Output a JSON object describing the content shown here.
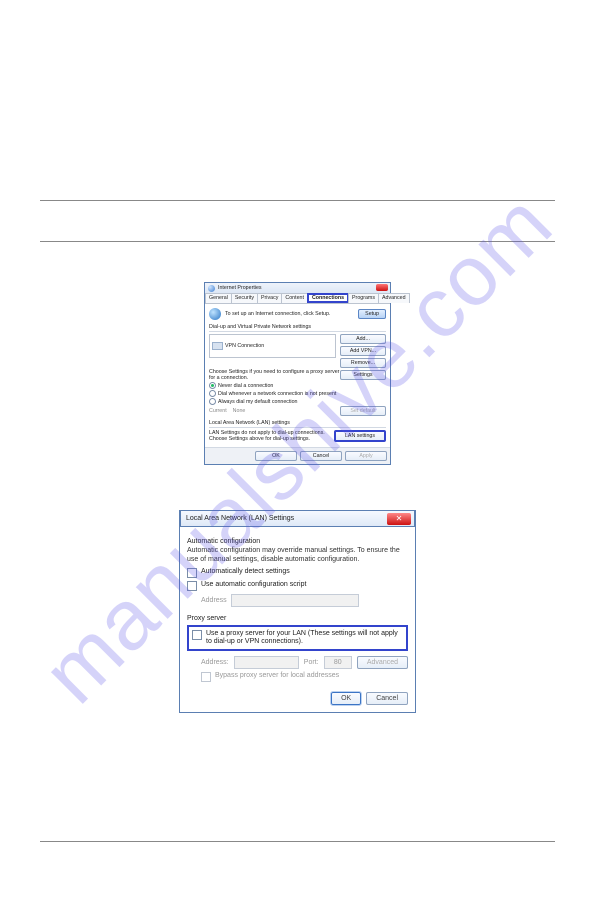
{
  "watermark": "manualshive.com",
  "dlg1": {
    "title": "Internet Properties",
    "tabs": [
      "General",
      "Security",
      "Privacy",
      "Content",
      "Connections",
      "Programs",
      "Advanced"
    ],
    "intro": "To set up an Internet connection, click Setup.",
    "setup_btn": "Setup",
    "group_dialup": "Dial-up and Virtual Private Network settings",
    "vpn_item": "VPN Connection",
    "add_btn": "Add...",
    "add_vpn_btn": "Add VPN...",
    "remove_btn": "Remove...",
    "settings_note": "Choose Settings if you need to configure a proxy server for a connection.",
    "settings_btn": "Settings",
    "radio_never": "Never dial a connection",
    "radio_when": "Dial whenever a network connection is not present",
    "radio_always": "Always dial my default connection",
    "current_lbl": "Current",
    "current_val": "None",
    "set_default_btn": "Set default",
    "group_lan": "Local Area Network (LAN) settings",
    "lan_note": "LAN Settings do not apply to dial-up connections. Choose Settings above for dial-up settings.",
    "lan_btn": "LAN settings",
    "ok": "OK",
    "cancel": "Cancel",
    "apply": "Apply"
  },
  "dlg2": {
    "title": "Local Area Network (LAN) Settings",
    "group_auto": "Automatic configuration",
    "auto_desc": "Automatic configuration may override manual settings. To ensure the use of manual settings, disable automatic configuration.",
    "cb_auto_detect": "Automatically detect settings",
    "cb_auto_script": "Use automatic configuration script",
    "addr_lbl": "Address",
    "group_proxy": "Proxy server",
    "cb_proxy": "Use a proxy server for your LAN (These settings will not apply to dial-up or VPN connections).",
    "port_lbl": "Port:",
    "port_val": "80",
    "advanced_btn": "Advanced",
    "cb_bypass": "Bypass proxy server for local addresses",
    "ok": "OK",
    "cancel": "Cancel",
    "addr2_lbl": "Address:"
  }
}
